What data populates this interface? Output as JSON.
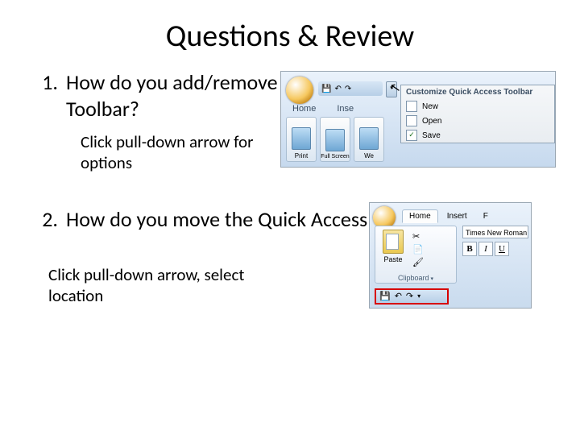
{
  "title": "Questions & Review",
  "q1": {
    "num": "1.",
    "text": "How do you add/remove buttons from the Quick Access Toolbar?",
    "ans": "Click pull-down arrow for options"
  },
  "q2": {
    "num": "2.",
    "text": "How do you move the Quick Access Toolbar?",
    "ans": "Click pull-down arrow, select location"
  },
  "shot1": {
    "tabHome": "Home",
    "tabInsert": "Inse",
    "btnPrint": "Print",
    "btnFull": "Full Screen",
    "btnWeb": "We",
    "menuHdr": "Customize Quick Access Toolbar",
    "miNew": "New",
    "miOpen": "Open",
    "miSave": "Save"
  },
  "shot2": {
    "tabHome": "Home",
    "tabInsert": "Insert",
    "tabF": "F",
    "font": "Times New Roman",
    "paste": "Paste",
    "clipboard": "Clipboard",
    "b": "B",
    "i": "I",
    "u": "U"
  }
}
